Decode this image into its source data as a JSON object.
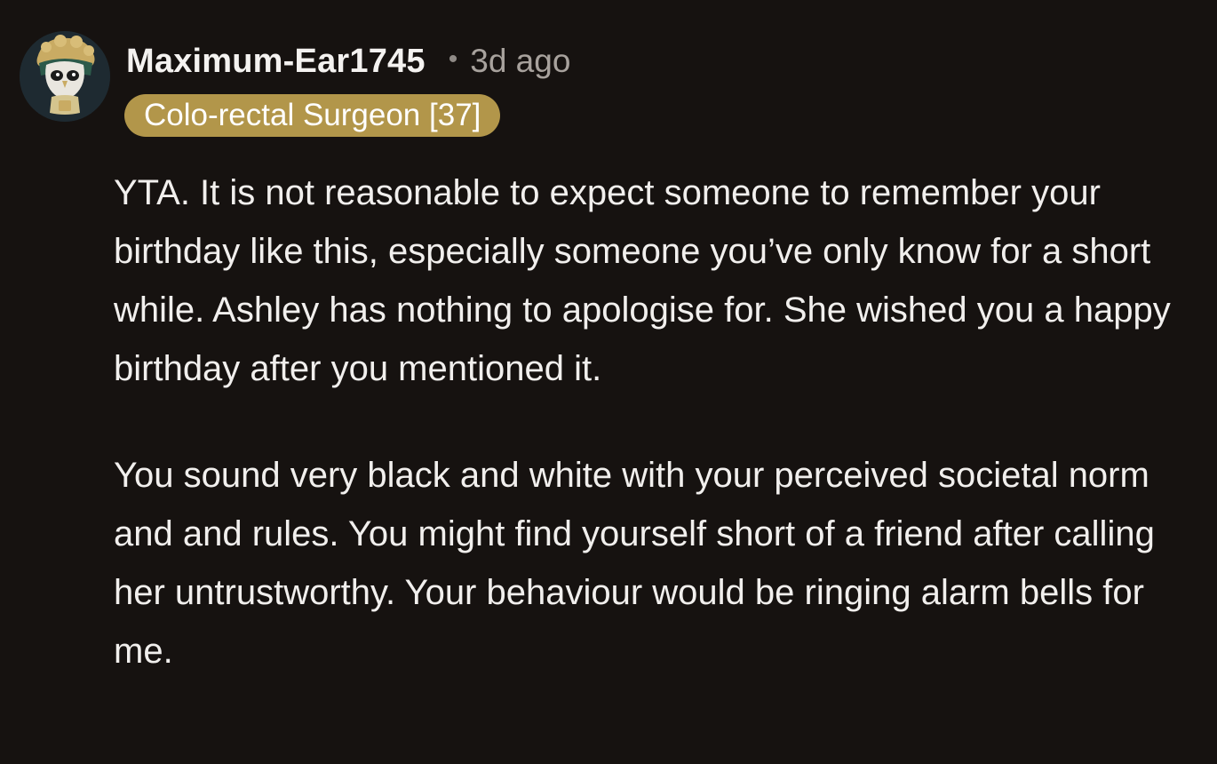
{
  "comment": {
    "author": "Maximum-Ear1745",
    "separator": "•",
    "timestamp": "3d ago",
    "flair": "Colo-rectal Surgeon [37]",
    "avatar_icon": "owl-mask-avatar-icon",
    "paragraphs": [
      "YTA. It is not reasonable to expect someone to remember your birthday like this, especially someone you’ve only know for a short while. Ashley has nothing to apologise for. She wished you a happy birthday after you mentioned it.",
      "You sound very black and white with your perceived societal norm and and rules. You might find yourself short of a friend after calling her untrustworthy. Your behaviour would be ringing alarm bells for me."
    ]
  },
  "colors": {
    "background": "#161210",
    "flair": "#b2964a",
    "text": "#f1efed",
    "muted": "#a8a29d"
  }
}
